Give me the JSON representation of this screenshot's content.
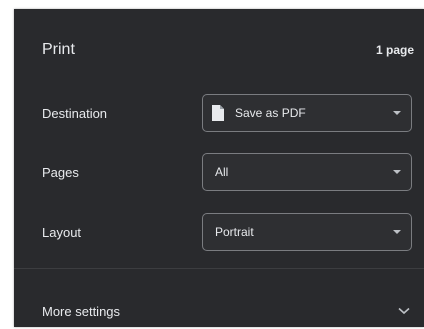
{
  "header": {
    "title": "Print",
    "page_count": "1 page"
  },
  "destination": {
    "label": "Destination",
    "value": "Save as PDF",
    "icon": "document-icon"
  },
  "pages": {
    "label": "Pages",
    "value": "All"
  },
  "layout": {
    "label": "Layout",
    "value": "Portrait"
  },
  "more_settings": {
    "label": "More settings",
    "icon": "chevron-down-icon"
  },
  "colors": {
    "panel_bg": "#292a2d",
    "text": "#e8eaed",
    "border": "#7a7c80"
  }
}
